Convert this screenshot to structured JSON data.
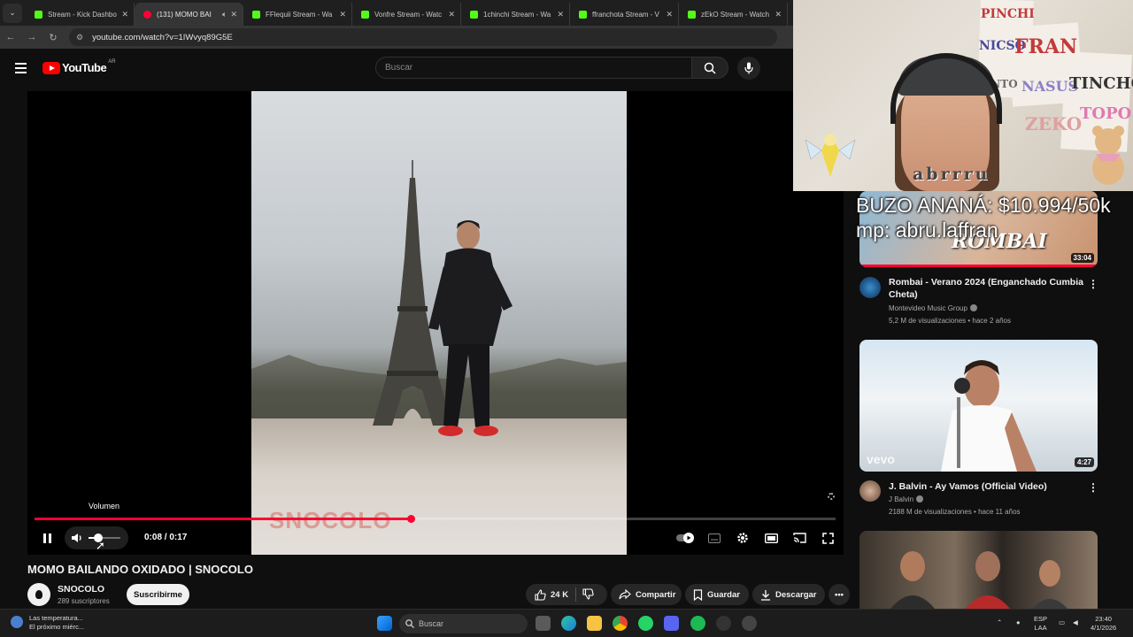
{
  "browser": {
    "tabs": [
      {
        "title": "Stream - Kick Dashbo",
        "favicon": "kick-icon",
        "active": false
      },
      {
        "title": "(131) MOMO BAI",
        "favicon": "youtube-icon",
        "active": true
      },
      {
        "title": "FFlequii Stream - Wa",
        "favicon": "kick-icon",
        "active": false
      },
      {
        "title": "Vonfre Stream - Watc",
        "favicon": "kick-icon",
        "active": false
      },
      {
        "title": "1chinchi Stream - Wa",
        "favicon": "kick-icon",
        "active": false
      },
      {
        "title": "ffranchota Stream - V",
        "favicon": "kick-icon",
        "active": false
      },
      {
        "title": "zEkO Stream - Watch",
        "favicon": "kick-icon",
        "active": false
      }
    ],
    "url": "youtube.com/watch?v=1IWvyq89G5E"
  },
  "youtube": {
    "logo_text": "YouTube",
    "country_code": "AR",
    "search_placeholder": "Buscar"
  },
  "player": {
    "tooltip": "Volumen",
    "time": "0:08 / 0:17",
    "progress_fraction": 0.47,
    "volume_fraction": 0.3,
    "watermark": "SNOCOLO"
  },
  "video": {
    "title": "MOMO BAILANDO OXIDADO | SNOCOLO",
    "channel": "SNOCOLO",
    "subscribers": "289 suscriptores",
    "subscribe_label": "Suscribirme",
    "likes": "24 K",
    "share_label": "Compartir",
    "save_label": "Guardar",
    "download_label": "Descargar"
  },
  "overlay": {
    "streamer_name": "abrrru",
    "promo_line1": "BUZO ANANÁ: $10.994/50k",
    "promo_line2": "mp: abru.laffran",
    "posters": [
      "PINCHI",
      "NICSO",
      "ANTO",
      "FRAN",
      "NASUS",
      "ZEKO",
      "TINCHO",
      "TOPO"
    ]
  },
  "sidebar": [
    {
      "duration": "33:04",
      "title": "Rombai - Verano 2024 (Enganchado Cumbia Cheta)",
      "channel": "Montevideo Music Group",
      "meta": "5,2 M de visualizaciones • hace 2 años",
      "thumb_label": "ROMBAI"
    },
    {
      "duration": "4:27",
      "title": "J. Balvin - Ay Vamos (Official Video)",
      "channel": "J Balvin",
      "meta": "2188 M de visualizaciones • hace 11 años",
      "thumb_label": "vevo"
    },
    {
      "duration": "",
      "title": "",
      "channel": "",
      "meta": "",
      "thumb_label": ""
    }
  ],
  "taskbar": {
    "weather_line1": "Las temperatura...",
    "weather_line2": "El próximo miérc...",
    "search_placeholder": "Buscar",
    "lang_line1": "ESP",
    "lang_line2": "LAA",
    "time": "23:40",
    "date": "4/1/2026"
  },
  "colors": {
    "yt_red": "#ff0033",
    "background": "#0f0f0f",
    "kick_green": "#53fc18"
  }
}
